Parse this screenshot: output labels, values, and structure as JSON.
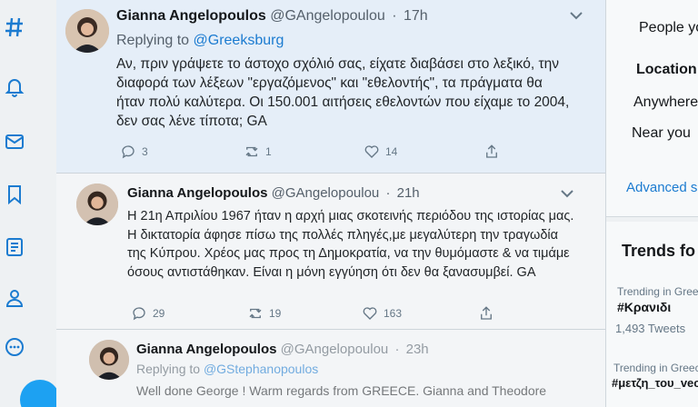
{
  "sidebar": {
    "items": [
      {
        "icon": "hashtag-icon"
      },
      {
        "icon": "bell-icon"
      },
      {
        "icon": "mail-icon"
      },
      {
        "icon": "bookmark-icon"
      },
      {
        "icon": "list-icon"
      },
      {
        "icon": "profile-icon"
      },
      {
        "icon": "more-icon"
      }
    ]
  },
  "tweets": [
    {
      "name": "Gianna Angelopoulos",
      "handle": "@GAngelopoulou",
      "time": "17h",
      "replying_label": "Replying to",
      "replying_user": "@Greeksburg",
      "text": "Αν, πριν γράψετε το άστοχο σχόλιό σας, είχατε διαβάσει στο λεξικό, την διαφορά των λέξεων \"εργαζόμενος\" και \"εθελοντής\", τα πράγματα θα ήταν πολύ καλύτερα. Οι 150.001 αιτήσεις εθελοντών που είχαμε το 2004, δεν σας λένε τίποτα; GA",
      "replies": "3",
      "retweets": "1",
      "likes": "14"
    },
    {
      "name": "Gianna Angelopoulos",
      "handle": "@GAngelopoulou",
      "time": "21h",
      "text": "Η 21η Απριλίου 1967 ήταν η αρχή μιας σκοτεινής περιόδου της ιστορίας μας. Η δικτατορία άφησε πίσω της πολλές πληγές,με μεγαλύτερη την τραγωδία της Κύπρου. Χρέος μας προς τη Δημοκρατία, να την θυμόμαστε & να τιμάμε όσους αντιστάθηκαν. Είναι η μόνη εγγύηση ότι δεν θα ξανασυμβεί. GA",
      "replies": "29",
      "retweets": "19",
      "likes": "163"
    },
    {
      "name": "Gianna Angelopoulos",
      "handle": "@GAngelopoulou",
      "time": "23h",
      "replying_label": "Replying to",
      "replying_user": "@GStephanopoulos",
      "text": "Well done George ! Warm regards from GREECE. Gianna and Theodore"
    }
  ],
  "right": {
    "people_label": "People yo",
    "location_heading": "Location",
    "anywhere_label": "Anywhere",
    "near_you_label": "Near you",
    "advanced_search": "Advanced se",
    "trends_heading": "Trends fo",
    "trends": [
      {
        "context": "Trending in Greece",
        "name": "#Κρανιδι",
        "count": "1,493 Tweets"
      },
      {
        "context": "Trending in Greece",
        "name": "#μετζη_του_vec"
      }
    ]
  },
  "colors": {
    "accent": "#1b7bd0",
    "secondary_text": "#657786"
  }
}
